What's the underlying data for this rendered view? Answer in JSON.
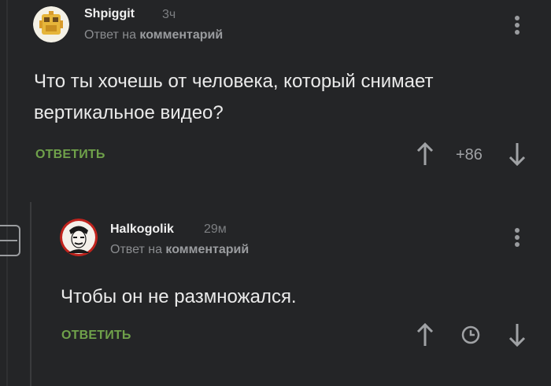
{
  "comments": [
    {
      "author": "Shpiggit",
      "time": "3ч",
      "reply_prefix": "Ответ на",
      "reply_target": "комментарий",
      "text": "Что ты хочешь от человека, который снимает вертикальное видео?",
      "reply_label": "ОТВЕТИТЬ",
      "rating": "+86",
      "avatar_icon": "yellow-robot-avatar"
    },
    {
      "author": "Halkogolik",
      "time": "29м",
      "reply_prefix": "Ответ на",
      "reply_target": "комментарий",
      "text": "Чтобы он не размножался.",
      "reply_label": "ОТВЕТИТЬ",
      "avatar_icon": "man-portrait-avatar"
    }
  ],
  "colors": {
    "background": "#242527",
    "accent_green": "#6fa14a",
    "muted": "#8a8c8f"
  }
}
